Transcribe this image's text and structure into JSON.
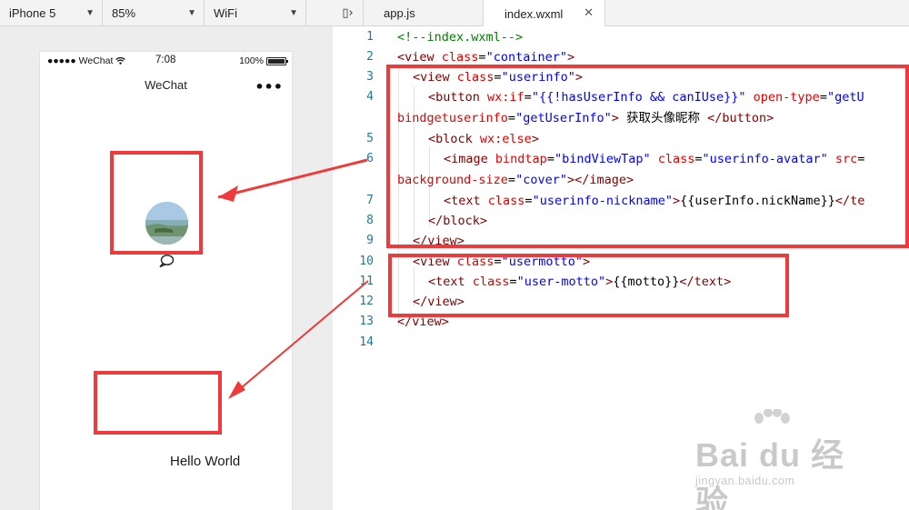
{
  "simulator": {
    "device": "iPhone 5",
    "zoom": "85%",
    "network": "WiFi",
    "status": {
      "carrier": "●●●●● WeChat",
      "time": "7:08",
      "battery": "100%"
    },
    "nav_title": "WeChat",
    "nav_menu": "•••",
    "motto": "Hello World"
  },
  "editor": {
    "tabs": [
      "app.js",
      "index.wxml"
    ],
    "close_glyph": "✕",
    "line_numbers": [
      "1",
      "2",
      "3",
      "4",
      "5",
      "6",
      "7",
      "8",
      "9",
      "10",
      "11",
      "12",
      "13",
      "14"
    ],
    "lines": [
      [
        {
          "c": "comment",
          "t": "<!--index.wxml-->"
        }
      ],
      [
        {
          "c": "tag",
          "t": "<view "
        },
        {
          "c": "attr",
          "t": "class"
        },
        {
          "c": "text",
          "t": "="
        },
        {
          "c": "val",
          "t": "\"container\""
        },
        {
          "c": "tag",
          "t": ">"
        }
      ],
      [
        {
          "c": "tag",
          "t": "<view "
        },
        {
          "c": "attr",
          "t": "class"
        },
        {
          "c": "text",
          "t": "="
        },
        {
          "c": "val",
          "t": "\"userinfo\""
        },
        {
          "c": "tag",
          "t": ">"
        }
      ],
      [
        {
          "c": "tag",
          "t": "<button "
        },
        {
          "c": "attr",
          "t": "wx:if"
        },
        {
          "c": "text",
          "t": "="
        },
        {
          "c": "val",
          "t": "\"{{!hasUserInfo && canIUse}}\""
        },
        {
          "c": "text",
          "t": " "
        },
        {
          "c": "attr",
          "t": "open-type"
        },
        {
          "c": "text",
          "t": "="
        },
        {
          "c": "val",
          "t": "\"getU"
        }
      ],
      [
        {
          "c": "attr",
          "t": "bindgetuserinfo"
        },
        {
          "c": "text",
          "t": "="
        },
        {
          "c": "val",
          "t": "\"getUserInfo\""
        },
        {
          "c": "tag",
          "t": ">"
        },
        {
          "c": "text",
          "t": " 获取头像昵称 "
        },
        {
          "c": "tag",
          "t": "</button>"
        }
      ],
      [
        {
          "c": "tag",
          "t": "<block "
        },
        {
          "c": "attr",
          "t": "wx:else"
        },
        {
          "c": "tag",
          "t": ">"
        }
      ],
      [
        {
          "c": "tag",
          "t": "<image "
        },
        {
          "c": "attr",
          "t": "bindtap"
        },
        {
          "c": "text",
          "t": "="
        },
        {
          "c": "val",
          "t": "\"bindViewTap\""
        },
        {
          "c": "text",
          "t": " "
        },
        {
          "c": "attr",
          "t": "class"
        },
        {
          "c": "text",
          "t": "="
        },
        {
          "c": "val",
          "t": "\"userinfo-avatar\""
        },
        {
          "c": "text",
          "t": " "
        },
        {
          "c": "attr",
          "t": "src"
        },
        {
          "c": "text",
          "t": "="
        }
      ],
      [
        {
          "c": "attr",
          "t": "background-size"
        },
        {
          "c": "text",
          "t": "="
        },
        {
          "c": "val",
          "t": "\"cover\""
        },
        {
          "c": "tag",
          "t": "></image>"
        }
      ],
      [
        {
          "c": "tag",
          "t": "<text "
        },
        {
          "c": "attr",
          "t": "class"
        },
        {
          "c": "text",
          "t": "="
        },
        {
          "c": "val",
          "t": "\"userinfo-nickname\""
        },
        {
          "c": "tag",
          "t": ">"
        },
        {
          "c": "text",
          "t": "{{userInfo.nickName}}"
        },
        {
          "c": "tag",
          "t": "</te"
        }
      ],
      [
        {
          "c": "tag",
          "t": "</block>"
        }
      ],
      [
        {
          "c": "tag",
          "t": "</view>"
        }
      ],
      [
        {
          "c": "tag",
          "t": "<view "
        },
        {
          "c": "attr",
          "t": "class"
        },
        {
          "c": "text",
          "t": "="
        },
        {
          "c": "val",
          "t": "\"usermotto\""
        },
        {
          "c": "tag",
          "t": ">"
        }
      ],
      [
        {
          "c": "tag",
          "t": "<text "
        },
        {
          "c": "attr",
          "t": "class"
        },
        {
          "c": "text",
          "t": "="
        },
        {
          "c": "val",
          "t": "\"user-motto\""
        },
        {
          "c": "tag",
          "t": ">"
        },
        {
          "c": "text",
          "t": "{{motto}}"
        },
        {
          "c": "tag",
          "t": "</text>"
        }
      ],
      [
        {
          "c": "tag",
          "t": "</view>"
        }
      ],
      [
        {
          "c": "tag",
          "t": "</view>"
        }
      ]
    ]
  },
  "watermark": {
    "brand": "Bai du 经验",
    "site": "jingyan.baidu.com"
  },
  "colors": {
    "annotation": "#ee3a3a",
    "comment": "#008000",
    "tag": "#800000",
    "attr": "#e50000",
    "value": "#0000ff",
    "line_number": "#237893"
  }
}
